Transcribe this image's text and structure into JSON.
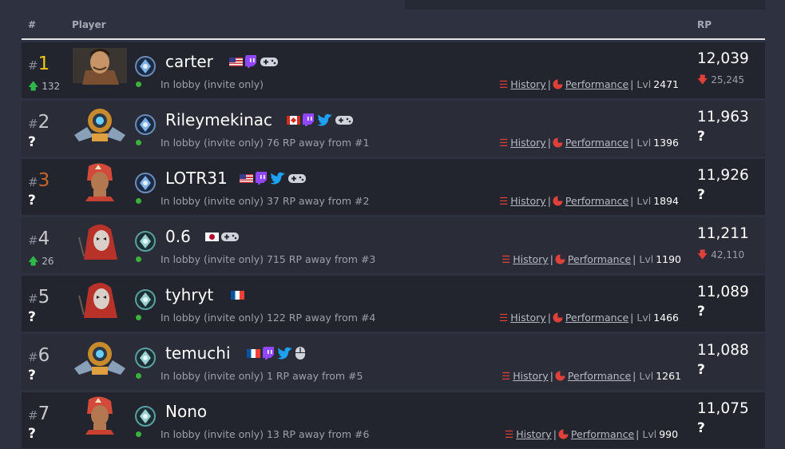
{
  "header": {
    "rank_col": "#",
    "player_col": "Player",
    "rp_col": "RP"
  },
  "labels": {
    "history": "History",
    "performance": "Performance",
    "lvl": "Lvl",
    "unknown": "?"
  },
  "colors": {
    "gold": "#f0c419",
    "bronze": "#c5672b",
    "online": "#3bb33b",
    "twitch": "#9146ff",
    "twitter": "#1da1f2",
    "down": "#e0403a",
    "up": "#2fb84a"
  },
  "rows": [
    {
      "rank": "1",
      "hash": "#",
      "delta": "132",
      "name": "carter",
      "status": "In lobby (invite only)",
      "lvl": "2471",
      "rp": "12,039",
      "rp_change": "25,245",
      "icons": [
        "flag-us",
        "twitch-icon",
        "gamepad-icon"
      ]
    },
    {
      "rank": "2",
      "hash": "#",
      "delta": "?",
      "name": "Rileymekinac",
      "status": "In lobby (invite only) 76 RP away from #1",
      "lvl": "1396",
      "rp": "11,963",
      "rp_change": "?",
      "icons": [
        "flag-ca",
        "twitch-icon",
        "twitter-icon",
        "gamepad-icon"
      ]
    },
    {
      "rank": "3",
      "hash": "#",
      "delta": "?",
      "name": "LOTR31",
      "status": "In lobby (invite only) 37 RP away from #2",
      "lvl": "1894",
      "rp": "11,926",
      "rp_change": "?",
      "icons": [
        "flag-us",
        "twitch-icon",
        "twitter-icon",
        "gamepad-icon"
      ]
    },
    {
      "rank": "4",
      "hash": "#",
      "delta": "26",
      "name": "0.6",
      "status": "In lobby (invite only) 715 RP away from #3",
      "lvl": "1190",
      "rp": "11,211",
      "rp_change": "42,110",
      "icons": [
        "flag-jp",
        "gamepad-icon"
      ]
    },
    {
      "rank": "5",
      "hash": "#",
      "delta": "?",
      "name": "tyhryt",
      "status": "In lobby (invite only) 122 RP away from #4",
      "lvl": "1466",
      "rp": "11,089",
      "rp_change": "?",
      "icons": [
        "flag-fr"
      ]
    },
    {
      "rank": "6",
      "hash": "#",
      "delta": "?",
      "name": "temuchi",
      "status": "In lobby (invite only) 1 RP away from #5",
      "lvl": "1261",
      "rp": "11,088",
      "rp_change": "?",
      "icons": [
        "flag-fr",
        "twitch-icon",
        "twitter-icon",
        "mouse-icon"
      ]
    },
    {
      "rank": "7",
      "hash": "#",
      "delta": "?",
      "name": "Nono",
      "status": "In lobby (invite only) 13 RP away from #6",
      "lvl": "990",
      "rp": "11,075",
      "rp_change": "?",
      "icons": []
    }
  ]
}
